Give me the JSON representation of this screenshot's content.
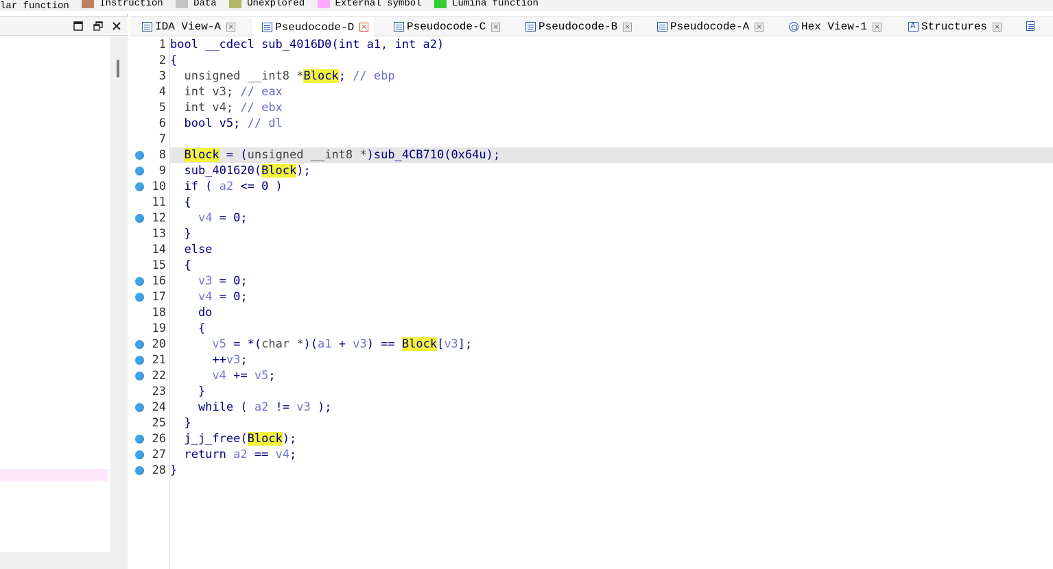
{
  "legend": [
    {
      "label": "lar function",
      "color": null
    },
    {
      "label": "Instruction",
      "color": "#c08060"
    },
    {
      "label": "Data",
      "color": "#c4c4c4"
    },
    {
      "label": "Unexplored",
      "color": "#b5b56a"
    },
    {
      "label": "External symbol",
      "color": "#ffaaff"
    },
    {
      "label": "Lumina function",
      "color": "#33cc33"
    }
  ],
  "left_panel": {
    "maximize_icon": "maximize-icon",
    "restore_icon": "restore-icon",
    "close_icon": "close-icon"
  },
  "tabs": [
    {
      "label": "IDA View-A",
      "icon": "disassembly-view-icon",
      "active": false
    },
    {
      "label": "Pseudocode-D",
      "icon": "pseudocode-icon",
      "active": true
    },
    {
      "label": "Pseudocode-C",
      "icon": "pseudocode-icon",
      "active": false
    },
    {
      "label": "Pseudocode-B",
      "icon": "pseudocode-icon",
      "active": false
    },
    {
      "label": "Pseudocode-A",
      "icon": "pseudocode-icon",
      "active": false
    },
    {
      "label": "Hex View-1",
      "icon": "hex-view-icon",
      "active": false
    },
    {
      "label": "Structures",
      "icon": "structures-icon",
      "active": false
    }
  ],
  "code": {
    "current_line": 8,
    "lines": [
      {
        "n": "1",
        "bp": false
      },
      {
        "n": "2",
        "bp": false
      },
      {
        "n": "3",
        "bp": false
      },
      {
        "n": "4",
        "bp": false
      },
      {
        "n": "5",
        "bp": false
      },
      {
        "n": "6",
        "bp": false
      },
      {
        "n": "7",
        "bp": false
      },
      {
        "n": "8",
        "bp": true
      },
      {
        "n": "9",
        "bp": true
      },
      {
        "n": "10",
        "bp": true
      },
      {
        "n": "11",
        "bp": false
      },
      {
        "n": "12",
        "bp": true
      },
      {
        "n": "13",
        "bp": false
      },
      {
        "n": "14",
        "bp": false
      },
      {
        "n": "15",
        "bp": false
      },
      {
        "n": "16",
        "bp": true
      },
      {
        "n": "17",
        "bp": true
      },
      {
        "n": "18",
        "bp": false
      },
      {
        "n": "19",
        "bp": false
      },
      {
        "n": "20",
        "bp": true
      },
      {
        "n": "21",
        "bp": true
      },
      {
        "n": "22",
        "bp": true
      },
      {
        "n": "23",
        "bp": false
      },
      {
        "n": "24",
        "bp": true
      },
      {
        "n": "25",
        "bp": false
      },
      {
        "n": "26",
        "bp": true
      },
      {
        "n": "27",
        "bp": true
      },
      {
        "n": "28",
        "bp": true
      }
    ],
    "src": {
      "l1": {
        "a": "bool __cdecl sub_4016D0(int a1, int a2)"
      },
      "l2": {
        "a": "{"
      },
      "l3": {
        "a": "  ",
        "t": "unsigned __int8 *",
        "hl": "Block",
        "b": "; ",
        "c": "// ebp"
      },
      "l4": {
        "a": "  ",
        "t": "int v3; ",
        "c": "// eax"
      },
      "l5": {
        "a": "  ",
        "t": "int v4; ",
        "c": "// ebx"
      },
      "l6": {
        "a": "  ",
        "k": "bool v5; ",
        "c": "// dl"
      },
      "l7": {
        "a": ""
      },
      "l8": {
        "a": "  ",
        "hl": "Block",
        "b": " = (",
        "t": "unsigned __int8 *",
        "c2": ")sub_4CB710(0x64u);"
      },
      "l9": {
        "a": "  sub_401620(",
        "hl": "Block",
        "b": ");"
      },
      "l10": {
        "a": "  if ( ",
        "v": "a2",
        "b": " <= 0 )"
      },
      "l11": {
        "a": "  {"
      },
      "l12": {
        "a": "    ",
        "v": "v4",
        "b": " = 0;"
      },
      "l13": {
        "a": "  }"
      },
      "l14": {
        "a": "  else"
      },
      "l15": {
        "a": "  {"
      },
      "l16": {
        "a": "    ",
        "v": "v3",
        "b": " = 0;"
      },
      "l17": {
        "a": "    ",
        "v": "v4",
        "b": " = 0;"
      },
      "l18": {
        "a": "    do"
      },
      "l19": {
        "a": "    {"
      },
      "l20": {
        "a": "      ",
        "v": "v5",
        "b": " = *(",
        "t": "char *",
        "c2": ")(",
        "v2": "a1",
        "d": " + ",
        "v3": "v3",
        "e": ") == ",
        "hl": "Block",
        "f": "[",
        "v4": "v3",
        "g": "];"
      },
      "l21": {
        "a": "      ++",
        "v": "v3",
        "b": ";"
      },
      "l22": {
        "a": "      ",
        "v": "v4",
        "b": " += ",
        "v2": "v5",
        "d": ";"
      },
      "l23": {
        "a": "    }"
      },
      "l24": {
        "a": "    while ( ",
        "v": "a2",
        "b": " != ",
        "v2": "v3",
        "d": " );"
      },
      "l25": {
        "a": "  }"
      },
      "l26": {
        "a": "  j_j_free(",
        "hl": "Block",
        "b": ");"
      },
      "l27": {
        "a": "  return ",
        "v": "a2",
        "b": " == ",
        "v2": "v4",
        "d": ";"
      },
      "l28": {
        "a": "}"
      }
    }
  }
}
